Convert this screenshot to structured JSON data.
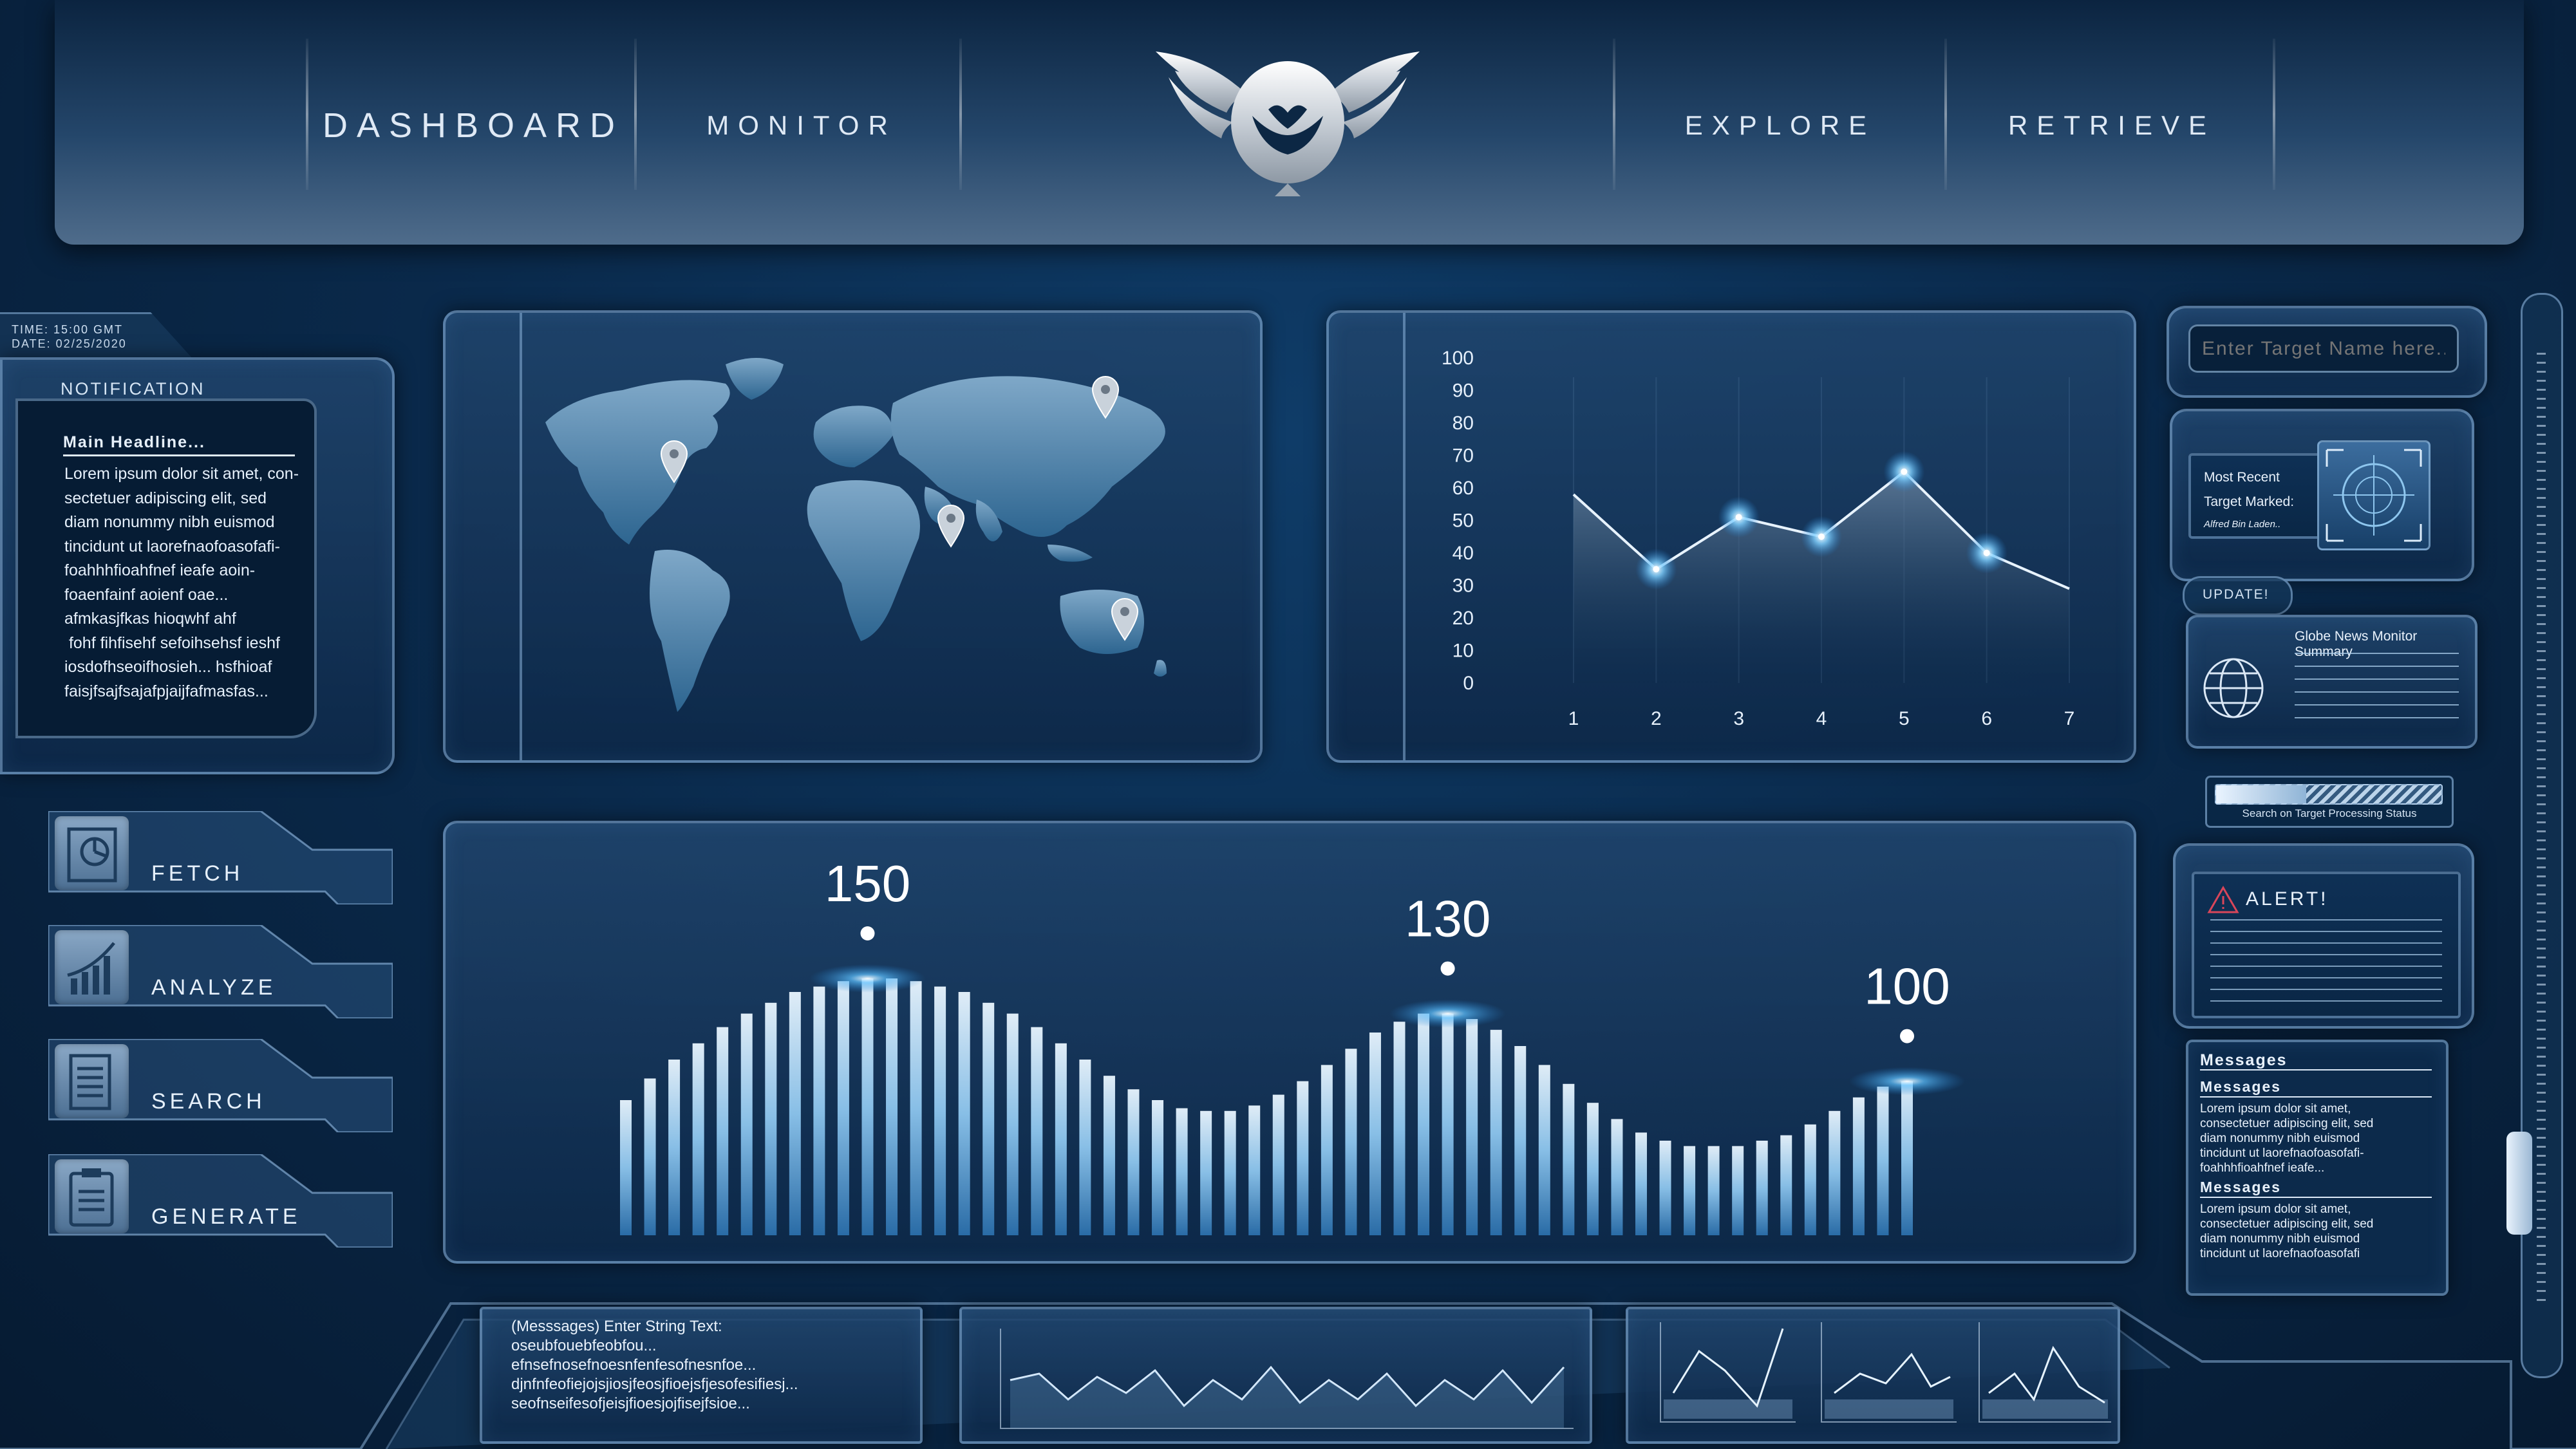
{
  "nav": {
    "dashboard": "DASHBOARD",
    "monitor": "MONITOR",
    "explore": "EXPLORE",
    "retrieve": "RETRIEVE"
  },
  "logo_icon": "winged-shield-logo",
  "header_info": {
    "time": "TIME: 15:00 GMT",
    "date": "DATE: 02/25/2020"
  },
  "notification": {
    "title": "NOTIFICATION",
    "headline": "Main Headline...",
    "body_lines": [
      "Lorem ipsum dolor sit amet, con-",
      "sectetuer adipiscing elit, sed",
      "diam nonummy nibh euismod",
      "tincidunt ut laorefnaofoasofafi-",
      "foahhhfioahfnef ieafe aoin-",
      "foaenfainf aoienf oae...",
      "afmkasjfkas hioqwhf ahf",
      " fohf fihfisehf sefoihsehsf ieshf",
      "iosdofhseoifhosieh... hsfhioaf",
      "faisjfsajfsajafpjaijfafmasfas..."
    ]
  },
  "side_buttons": [
    {
      "label": "FETCH",
      "icon": "presentation-chart-icon"
    },
    {
      "label": "ANALYZE",
      "icon": "growth-chart-icon"
    },
    {
      "label": "SEARCH",
      "icon": "document-list-icon"
    },
    {
      "label": "GENERATE",
      "icon": "clipboard-icon"
    }
  ],
  "map": {
    "pins": [
      "pin-north-america",
      "pin-middle-east",
      "pin-russia",
      "pin-australia"
    ]
  },
  "chart_data": [
    {
      "type": "area",
      "x": [
        1,
        2,
        3,
        4,
        5,
        6,
        7
      ],
      "values": [
        58,
        35,
        51,
        45,
        65,
        40,
        29
      ],
      "y_ticks": [
        0,
        10,
        20,
        30,
        40,
        50,
        60,
        70,
        80,
        90,
        100
      ],
      "ylim": [
        0,
        100
      ],
      "grid": false
    },
    {
      "type": "bar",
      "values": [
        50,
        58,
        65,
        71,
        77,
        82,
        86,
        90,
        92,
        94,
        95,
        95,
        94,
        92,
        90,
        86,
        82,
        77,
        71,
        65,
        59,
        54,
        50,
        47,
        46,
        46,
        48,
        52,
        57,
        63,
        69,
        75,
        79,
        82,
        82,
        80,
        76,
        70,
        63,
        56,
        49,
        43,
        38,
        35,
        33,
        33,
        33,
        35,
        37,
        41,
        46,
        51,
        55,
        57
      ],
      "annotations": [
        {
          "label": "150",
          "bar_index": 10
        },
        {
          "label": "130",
          "bar_index": 34
        },
        {
          "label": "100",
          "bar_index": 53
        }
      ]
    }
  ],
  "search": {
    "placeholder": "Enter Target Name here..."
  },
  "target": {
    "line1": "Most Recent",
    "line2": "Target Marked:",
    "name": "Alfred Bin Laden.."
  },
  "update": {
    "label": "UPDATE!",
    "title": "Globe News Monitor Summary"
  },
  "progress": {
    "label": "Search on Target Processing Status",
    "value": 0.4
  },
  "alert": {
    "label": "ALERT!"
  },
  "messages": {
    "title": "Messages",
    "sections": [
      {
        "heading": "Messages",
        "lines": [
          "Lorem ipsum dolor sit amet,",
          "consectetuer adipiscing elit, sed",
          "diam nonummy nibh euismod",
          "tincidunt ut laorefnaofoasofafi-",
          "foahhhfioahfnef ieafe..."
        ]
      },
      {
        "heading": "Messages",
        "lines": [
          "Lorem ipsum dolor sit amet,",
          "consectetuer adipiscing elit, sed",
          "diam nonummy nibh euismod",
          "tincidunt ut laorefnaofoasofafi"
        ]
      }
    ]
  },
  "string_panel": {
    "lines": [
      "(Messsages) Enter String Text:",
      "oseubfouebfeobfou...",
      "efnsefnosefnoesnfenfesofnesnfoe...",
      "djnfnfeofiejojsjiosjfeosjfioejsfjesofesifiesj...",
      "seofnseifesofjeisjfioesjojfisejfsioe..."
    ]
  },
  "bottom_colors": {
    "accent": "#7fd0ff",
    "bar_light": "#dff2ff",
    "bar_dark": "#3a86c4"
  }
}
